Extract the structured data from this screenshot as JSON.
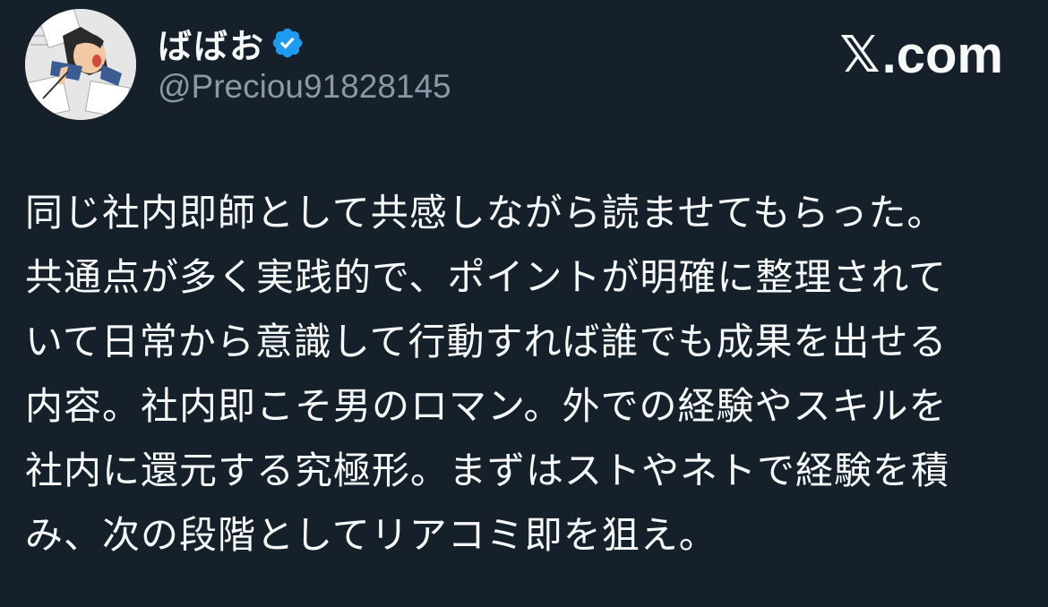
{
  "author": {
    "display_name": "ばばお",
    "handle": "@Preciou91828145",
    "verified": true,
    "verified_color": "#1d9bf0",
    "avatar_icon": "avatar-illustration-icon"
  },
  "brand": {
    "x_glyph": "𝕏",
    "domain": ".com"
  },
  "tweet": {
    "lines": [
      "同じ社内即師として共感しながら読ませてもらった。",
      "共通点が多く実践的で、ポイントが明確に整理されて",
      "いて日常から意識して行動すれば誰でも成果を出せる",
      "内容。社内即こそ男のロマン。外での経験やスキルを",
      "社内に還元する究極形。まずはストやネトで経験を積",
      "み、次の段階としてリアコミ即を狙え。"
    ]
  },
  "colors": {
    "background": "#15202b",
    "text": "#f7f9f9",
    "muted": "#8b98a5"
  }
}
